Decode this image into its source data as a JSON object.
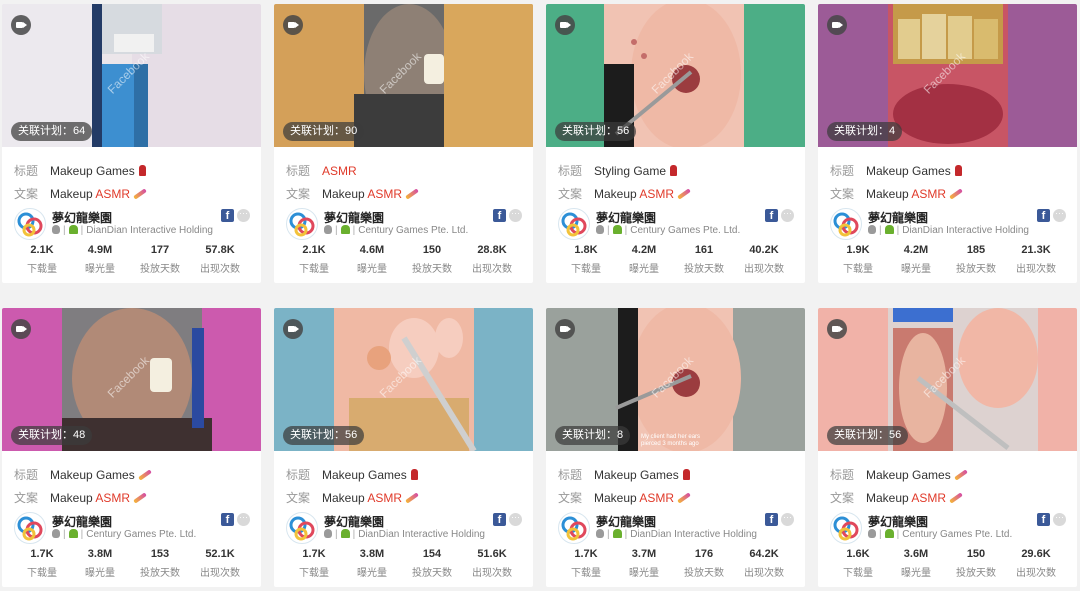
{
  "labels": {
    "title_key": "标题",
    "copy_key": "文案",
    "plan_prefix": "关联计划：",
    "watermark": "Facebook",
    "downloads": "下载量",
    "impressions": "曝光量",
    "days": "投放天数",
    "appearances": "出现次数",
    "fb_letter": "f",
    "more": "···",
    "separator": "|"
  },
  "colors": {
    "accent_red": "#e03a2a",
    "facebook": "#3b5998"
  },
  "cards": [
    {
      "plan": "64",
      "title": "Makeup Games",
      "title_icon": "lipstick-icon",
      "copy_prefix": "Makeup ",
      "copy_highlight": "ASMR",
      "copy_icon": "pen-icon",
      "app": "夢幻龍樂園",
      "publisher": "DianDian Interactive Holding",
      "downloads": "2.1K",
      "impressions": "4.9M",
      "days": "177",
      "appearances": "57.8K",
      "thumb": "room"
    },
    {
      "plan": "90",
      "title": "",
      "title_highlight": "ASMR",
      "copy_prefix": "Makeup ",
      "copy_highlight": "ASMR",
      "copy_icon": "pen-icon",
      "app": "夢幻龍樂園",
      "publisher": "Century Games Pte. Ltd.",
      "downloads": "2.1K",
      "impressions": "4.6M",
      "days": "150",
      "appearances": "28.8K",
      "thumb": "oldman-gold"
    },
    {
      "plan": "56",
      "title": "Styling Game",
      "title_icon": "lipstick-icon",
      "copy_prefix": "Makeup ",
      "copy_highlight": "ASMR",
      "copy_icon": "pen-icon",
      "app": "夢幻龍樂園",
      "publisher": "Century Games Pte. Ltd.",
      "downloads": "1.8K",
      "impressions": "4.2M",
      "days": "161",
      "appearances": "40.2K",
      "thumb": "ear-green"
    },
    {
      "plan": "4",
      "title": "Makeup Games",
      "title_icon": "lipstick-icon",
      "copy_prefix": "Makeup ",
      "copy_highlight": "ASMR",
      "copy_icon": "pen-icon",
      "app": "夢幻龍樂園",
      "publisher": "DianDian Interactive Holding",
      "downloads": "1.9K",
      "impressions": "4.2M",
      "days": "185",
      "appearances": "21.3K",
      "thumb": "teeth"
    },
    {
      "plan": "48",
      "title": "Makeup Games",
      "title_icon": "pen-icon",
      "copy_prefix": "Makeup ",
      "copy_highlight": "ASMR",
      "copy_icon": "pen-icon",
      "app": "夢幻龍樂園",
      "publisher": "Century Games Pte. Ltd.",
      "downloads": "1.7K",
      "impressions": "3.8M",
      "days": "153",
      "appearances": "52.1K",
      "thumb": "oldman-pink"
    },
    {
      "plan": "56",
      "title": "Makeup Games",
      "title_icon": "lipstick-icon",
      "copy_prefix": "Makeup ",
      "copy_highlight": "ASMR",
      "copy_icon": "pen-icon",
      "app": "夢幻龍樂園",
      "publisher": "DianDian Interactive Holding",
      "downloads": "1.7K",
      "impressions": "3.8M",
      "days": "154",
      "appearances": "51.6K",
      "thumb": "foot"
    },
    {
      "plan": "8",
      "title": "Makeup Games",
      "title_icon": "lipstick-icon",
      "copy_prefix": "Makeup ",
      "copy_highlight": "ASMR",
      "copy_icon": "pen-icon",
      "app": "夢幻龍樂園",
      "publisher": "DianDian Interactive Holding",
      "downloads": "1.7K",
      "impressions": "3.7M",
      "days": "176",
      "appearances": "64.2K",
      "thumb": "ear-gray",
      "caption": "My client had her ears pierced 3 months ago"
    },
    {
      "plan": "56",
      "title": "Makeup Games",
      "title_icon": "pen-icon",
      "copy_prefix": "Makeup ",
      "copy_highlight": "ASMR",
      "copy_icon": "pen-icon",
      "app": "夢幻龍樂園",
      "publisher": "Century Games Pte. Ltd.",
      "downloads": "1.6K",
      "impressions": "3.6M",
      "days": "150",
      "appearances": "29.6K",
      "thumb": "nail"
    }
  ]
}
